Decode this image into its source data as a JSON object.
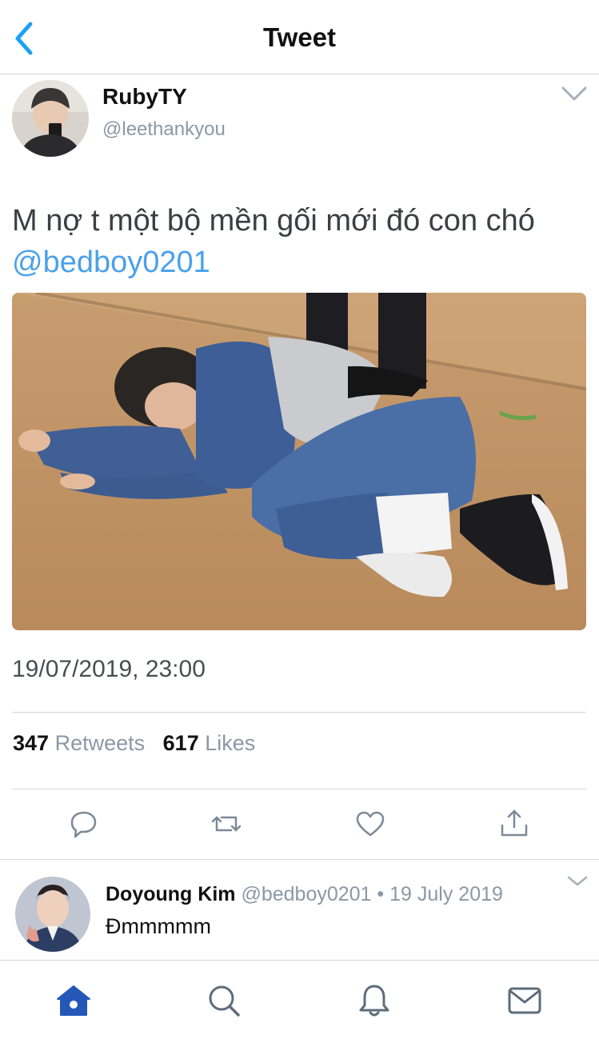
{
  "header": {
    "title": "Tweet"
  },
  "tweet": {
    "author_name": "RubyTY",
    "author_handle": "@leethankyou",
    "text": "M nợ t một bộ mền gối mới đó con chó ",
    "mention": "@bedboy0201",
    "timestamp": "19/07/2019, 23:00",
    "retweets_count": "347",
    "retweets_label": "Retweets",
    "likes_count": "617",
    "likes_label": "Likes"
  },
  "actions": [
    {
      "icon": "reply-icon"
    },
    {
      "icon": "retweet-icon"
    },
    {
      "icon": "heart-icon"
    },
    {
      "icon": "share-icon"
    }
  ],
  "reply": {
    "author_name": "Doyoung Kim",
    "author_handle": "@bedboy0201",
    "separator": "•",
    "date": "19 July 2019",
    "text": "Đmmmmm"
  },
  "tabbar": [
    {
      "icon": "home-icon",
      "active": true
    },
    {
      "icon": "search-icon"
    },
    {
      "icon": "notifications-icon"
    },
    {
      "icon": "messages-icon"
    }
  ],
  "colors": {
    "accent": "#1da1f2",
    "mention": "#4aa1ea",
    "active_tab": "#2457b8",
    "secondary_text": "#8b98a5"
  }
}
